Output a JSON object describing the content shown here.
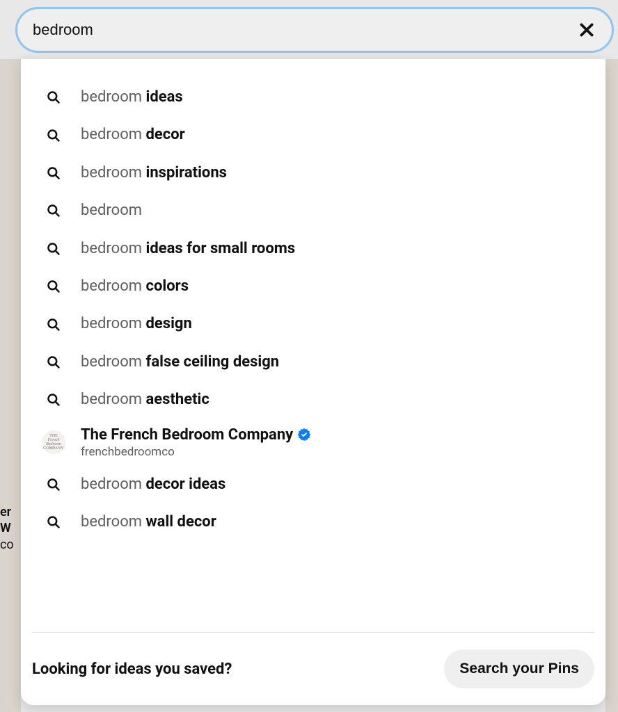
{
  "search": {
    "value": "bedroom",
    "placeholder": "Search"
  },
  "suggestions": [
    {
      "type": "query",
      "prefix": "bedroom ",
      "completion": "ideas"
    },
    {
      "type": "query",
      "prefix": "bedroom ",
      "completion": "decor"
    },
    {
      "type": "query",
      "prefix": "bedroom ",
      "completion": "inspirations"
    },
    {
      "type": "query",
      "prefix": "bedroom",
      "completion": ""
    },
    {
      "type": "query",
      "prefix": "bedroom ",
      "completion": "ideas for small rooms"
    },
    {
      "type": "query",
      "prefix": "bedroom ",
      "completion": "colors"
    },
    {
      "type": "query",
      "prefix": "bedroom ",
      "completion": "design"
    },
    {
      "type": "query",
      "prefix": "bedroom ",
      "completion": "false ceiling design"
    },
    {
      "type": "query",
      "prefix": "bedroom ",
      "completion": "aesthetic"
    },
    {
      "type": "profile",
      "name": "The French Bedroom Company",
      "handle": "frenchbedroomco",
      "verified": true
    },
    {
      "type": "query",
      "prefix": "bedroom ",
      "completion": "decor ideas"
    },
    {
      "type": "query",
      "prefix": "bedroom ",
      "completion": "wall decor"
    }
  ],
  "footer": {
    "prompt": "Looking for ideas you saved?",
    "button": "Search your Pins"
  },
  "colors": {
    "search_border": "#8fc4ef",
    "verified_blue": "#0a7cff"
  }
}
